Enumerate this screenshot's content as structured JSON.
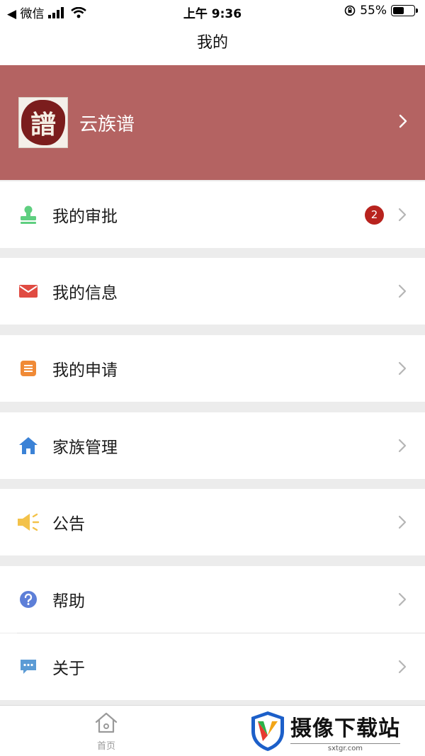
{
  "status_bar": {
    "back_app": "◀ 微信",
    "time": "上午 9:36",
    "battery": "55%",
    "battery_level": 0.55
  },
  "header": {
    "title": "我的"
  },
  "profile": {
    "avatar_char": "譜",
    "name": "云族谱"
  },
  "menu": {
    "approval": {
      "label": "我的审批",
      "badge": "2"
    },
    "messages": {
      "label": "我的信息"
    },
    "applications": {
      "label": "我的申请"
    },
    "family": {
      "label": "家族管理"
    },
    "announcement": {
      "label": "公告"
    },
    "help": {
      "label": "帮助"
    },
    "about": {
      "label": "关于"
    }
  },
  "tab_bar": {
    "home_label": "首页"
  },
  "watermark": {
    "title": "摄像下载站",
    "url": "sxtgr.com"
  },
  "colors": {
    "profile_bg": "#b46362",
    "badge": "#b8231e",
    "approval_icon": "#5fcf80",
    "message_icon": "#e04b42",
    "application_icon": "#f08a36",
    "family_icon": "#3b82d6",
    "announcement_icon": "#f3c24a",
    "help_icon": "#5d7fd8",
    "about_icon": "#5b9bd5"
  },
  "icons": {
    "approval": "stamp-icon",
    "messages": "envelope-icon",
    "applications": "document-icon",
    "family": "house-icon",
    "announcement": "megaphone-icon",
    "help": "question-circle-icon",
    "about": "chat-bubble-icon",
    "tab_home": "home-outline-icon"
  }
}
